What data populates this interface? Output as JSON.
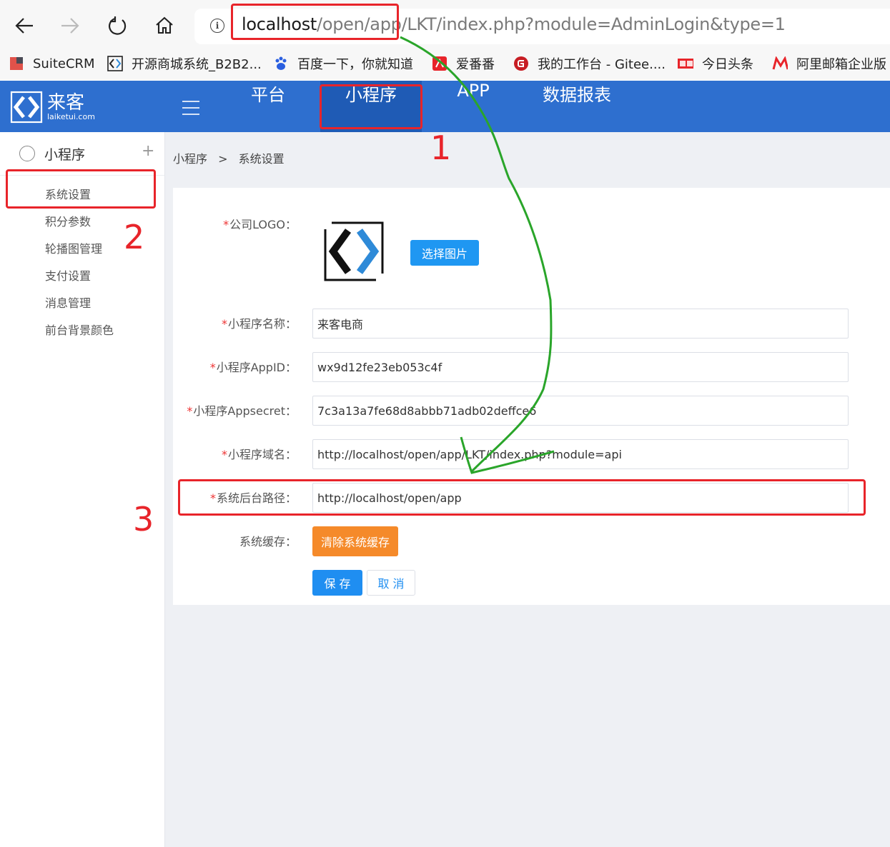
{
  "browser": {
    "url_host": "localhost",
    "url_rest": "/open/app/LKT/index.php?module=AdminLogin&type=1",
    "bookmarks": [
      {
        "label": "SuiteCRM",
        "icon": "suitecrm-icon"
      },
      {
        "label": "开源商城系统_B2B2...",
        "icon": "laike-icon"
      },
      {
        "label": "百度一下，你就知道",
        "icon": "baidu-paw-icon"
      },
      {
        "label": "爱番番",
        "icon": "aifanfan-icon"
      },
      {
        "label": "我的工作台 - Gitee....",
        "icon": "gitee-icon"
      },
      {
        "label": "今日头条",
        "icon": "toutiao-icon"
      },
      {
        "label": "阿里邮箱企业版",
        "icon": "aliyun-mail-icon"
      }
    ]
  },
  "header": {
    "logo_title": "来客",
    "logo_sub": "laiketui.com",
    "nav": [
      "平台",
      "小程序",
      "APP",
      "数据报表"
    ],
    "active_nav": "小程序",
    "brand_color": "#2e6fcf"
  },
  "sidebar": {
    "title": "小程序",
    "expand_symbol": "+",
    "items": [
      "系统设置",
      "积分参数",
      "轮播图管理",
      "支付设置",
      "消息管理",
      "前台背景颜色"
    ]
  },
  "breadcrumb": {
    "root": "小程序",
    "separator": ">",
    "current": "系统设置"
  },
  "form": {
    "required_mark": "*",
    "logo_label": "公司LOGO：",
    "choose_image_btn": "选择图片",
    "name_label": "小程序名称：",
    "name_value": "来客电商",
    "appid_label": "小程序AppID：",
    "appid_value": "wx9d12fe23eb053c4f",
    "appsecret_label": "小程序Appsecret：",
    "appsecret_value": "7c3a13a7fe68d8abbb71adb02deffce6",
    "domain_label": "小程序域名：",
    "domain_value": "http://localhost/open/app/LKT/index.php?module=api",
    "path_label": "系统后台路径：",
    "path_value": "http://localhost/open/app",
    "cache_label": "系统缓存：",
    "clear_cache_btn": "清除系统缓存",
    "save_btn": "保 存",
    "cancel_btn": "取 消"
  },
  "annotations": {
    "num1": "1",
    "num2": "2",
    "num3": "3",
    "red": "#e8242a",
    "green": "#2aa52a"
  }
}
